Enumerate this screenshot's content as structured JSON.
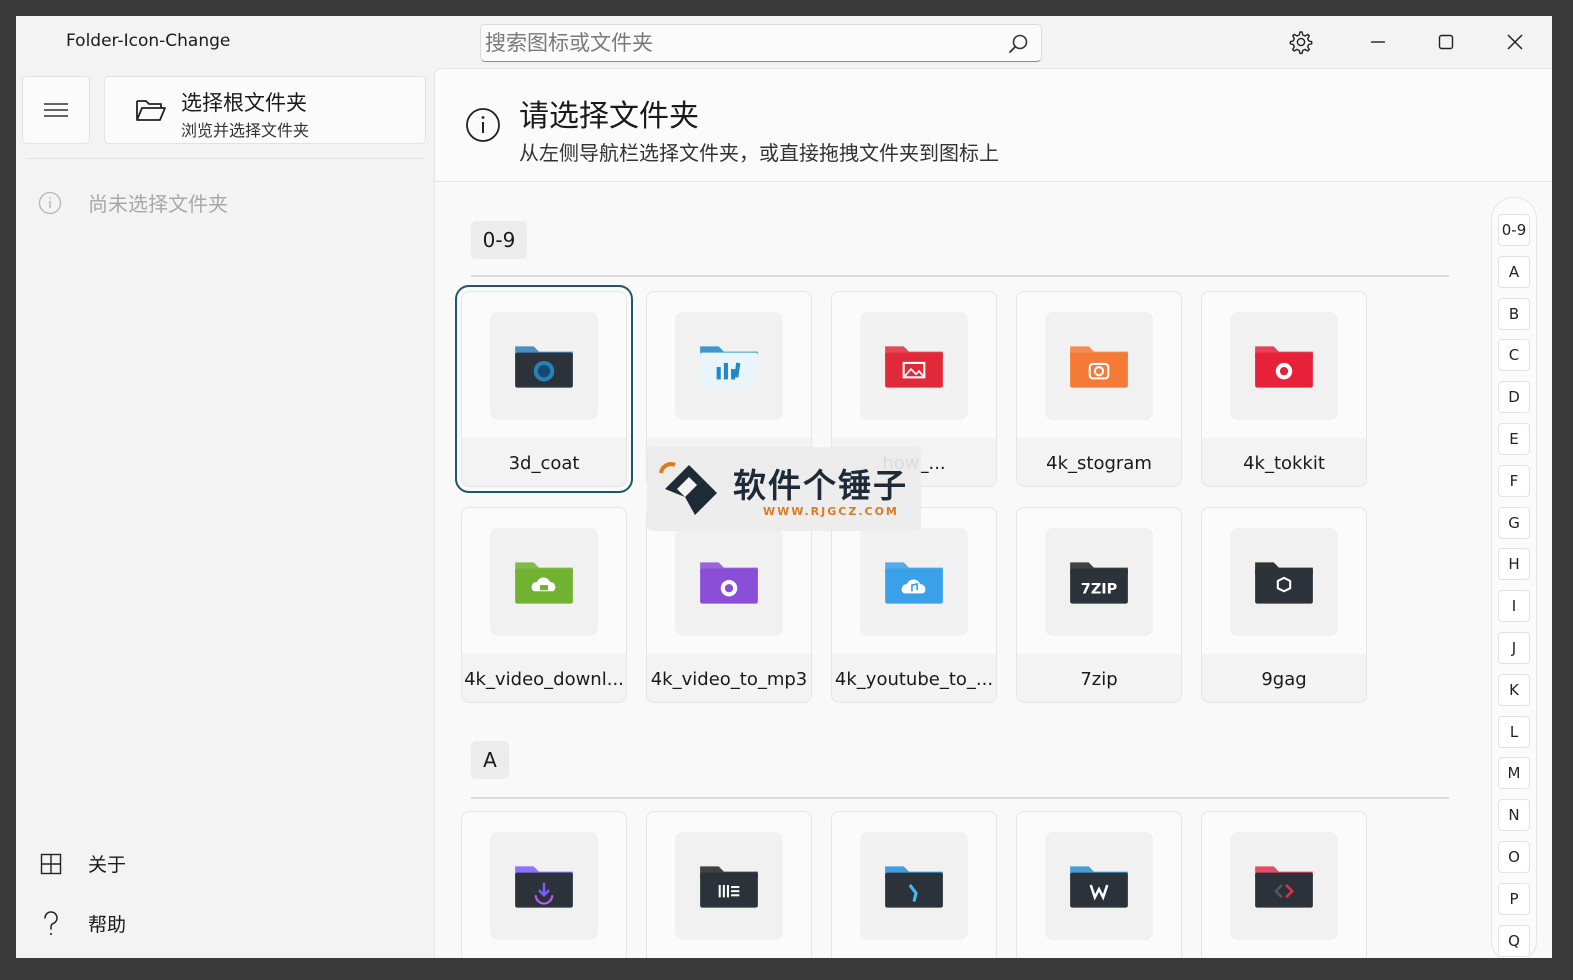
{
  "window": {
    "title": "Folder-Icon-Change"
  },
  "search": {
    "placeholder": "搜索图标或文件夹"
  },
  "sidebar": {
    "root_button": {
      "title": "选择根文件夹",
      "subtitle": "浏览并选择文件夹"
    },
    "status": "尚未选择文件夹",
    "bottom_items": [
      {
        "label": "关于",
        "icon": "grid-icon"
      },
      {
        "label": "帮助",
        "icon": "question-icon"
      }
    ]
  },
  "info": {
    "title": "请选择文件夹",
    "message": "从左侧导航栏选择文件夹，或直接拖拽文件夹到图标上"
  },
  "groups": [
    {
      "label": "0-9",
      "items": [
        {
          "name": "3d_coat",
          "icon": "3d-coat-folder-icon",
          "color": "#2a7fb8"
        },
        {
          "name": "",
          "icon": "chart-folder-icon",
          "color": "#1e88c8"
        },
        {
          "name": "how_...",
          "icon": "image-folder-icon",
          "color": "#e02a3a"
        },
        {
          "name": "4k_stogram",
          "icon": "camera-folder-icon",
          "color": "#f47a35"
        },
        {
          "name": "4k_tokkit",
          "icon": "tokkit-folder-icon",
          "color": "#e8213a"
        },
        {
          "name": "4k_video_downl...",
          "icon": "cloud-folder-icon",
          "color": "#72b231"
        },
        {
          "name": "4k_video_to_mp3",
          "icon": "headphones-folder-icon",
          "color": "#8a4fd6"
        },
        {
          "name": "4k_youtube_to_...",
          "icon": "music-cloud-folder-icon",
          "color": "#3aa0e8"
        },
        {
          "name": "7zip",
          "icon": "7zip-folder-icon",
          "color": "#222222"
        },
        {
          "name": "9gag",
          "icon": "9gag-folder-icon",
          "color": "#111111"
        }
      ]
    },
    {
      "label": "A",
      "items": [
        {
          "name": "",
          "icon": "download-folder-icon",
          "color": "#7a5cff"
        },
        {
          "name": "",
          "icon": "ableton-folder-icon",
          "color": "#222222"
        },
        {
          "name": "",
          "icon": "n-logo-folder-icon",
          "color": "#1e90d8"
        },
        {
          "name": "",
          "icon": "acer-folder-icon",
          "color": "#2a8ed0"
        },
        {
          "name": "",
          "icon": "code-folder-icon",
          "color": "#e03050"
        }
      ]
    }
  ],
  "alphabet": [
    "0-9",
    "A",
    "B",
    "C",
    "D",
    "E",
    "F",
    "G",
    "H",
    "I",
    "J",
    "K",
    "L",
    "M",
    "N",
    "O",
    "P",
    "Q"
  ],
  "watermark": {
    "text": "软件个锤子",
    "url": "WWW.RJGCZ.COM"
  }
}
